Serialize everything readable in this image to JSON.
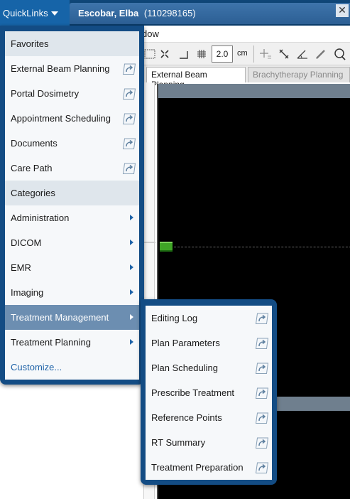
{
  "topbar": {
    "quicklinks_label": "QuickLinks",
    "patient_name": "Escobar, Elba",
    "patient_id": "(110298165)",
    "close_glyph": "✕"
  },
  "menubar": {
    "visible_text": "dow"
  },
  "toolbar": {
    "zoom_value": "2.0",
    "zoom_unit": "cm",
    "icons": [
      "zoom-region-icon",
      "fit-icon",
      "corner-icon",
      "grid-icon",
      "add-point-icon",
      "measure-icon",
      "angle-icon",
      "draw-icon",
      "magnify-icon"
    ]
  },
  "doc_tabs": [
    {
      "label": "External Beam Planning",
      "active": true
    },
    {
      "label": "Brachytherapy Planning",
      "active": false
    }
  ],
  "quicklinks": {
    "favorites_header": "Favorites",
    "favorites": [
      {
        "label": "External Beam Planning",
        "icon": "shortcut-link-icon"
      },
      {
        "label": "Portal Dosimetry",
        "icon": "shortcut-link-icon"
      },
      {
        "label": "Appointment Scheduling",
        "icon": "shortcut-link-icon"
      },
      {
        "label": "Documents",
        "icon": "shortcut-link-icon"
      },
      {
        "label": "Care Path",
        "icon": "shortcut-link-icon"
      }
    ],
    "categories_header": "Categories",
    "categories": [
      {
        "label": "Administration",
        "selected": false
      },
      {
        "label": "DICOM",
        "selected": false
      },
      {
        "label": "EMR",
        "selected": false
      },
      {
        "label": "Imaging",
        "selected": false
      },
      {
        "label": "Treatment Management",
        "selected": true
      },
      {
        "label": "Treatment Planning",
        "selected": false
      }
    ],
    "customize_label": "Customize..."
  },
  "submenu": {
    "items": [
      {
        "label": "Editing Log",
        "icon": "shortcut-link-icon"
      },
      {
        "label": "Plan Parameters",
        "icon": "shortcut-link-icon"
      },
      {
        "label": "Plan Scheduling",
        "icon": "shortcut-link-icon"
      },
      {
        "label": "Prescribe Treatment",
        "icon": "shortcut-link-icon"
      },
      {
        "label": "Reference Points",
        "icon": "shortcut-link-icon"
      },
      {
        "label": "RT Summary",
        "icon": "shortcut-link-icon"
      },
      {
        "label": "Treatment Preparation",
        "icon": "shortcut-link-icon"
      }
    ]
  },
  "colors": {
    "panel_blue": "#134c84",
    "selected_row": "#6c8eb1",
    "link_blue": "#1f63a8",
    "viewer_marker": "#3fa526"
  }
}
